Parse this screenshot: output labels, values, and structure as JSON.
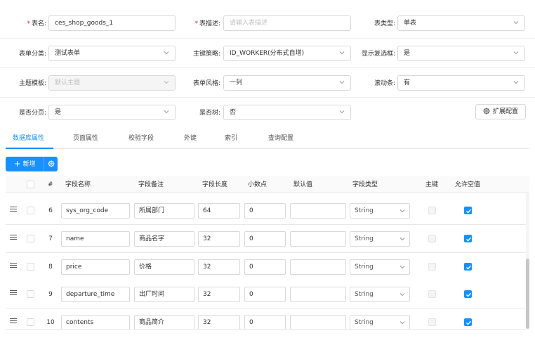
{
  "form": {
    "table_name": {
      "label": "表名:",
      "value": "ces_shop_goods_1"
    },
    "table_desc": {
      "label": "表描述:",
      "placeholder": "请输入表描述"
    },
    "table_type": {
      "label": "表类型:",
      "value": "单表"
    },
    "form_category": {
      "label": "表单分类:",
      "value": "测试表单"
    },
    "pk_strategy": {
      "label": "主键策略:",
      "value": "ID_WORKER(分布式自增)"
    },
    "show_checkbox": {
      "label": "显示复选框:",
      "value": "是"
    },
    "theme_template": {
      "label": "主题模板:",
      "value": "默认主题"
    },
    "form_style": {
      "label": "表单风格:",
      "value": "一列"
    },
    "scrollbar": {
      "label": "滚动条:",
      "value": "有"
    },
    "paging": {
      "label": "是否分页:",
      "value": "是"
    },
    "is_tree": {
      "label": "是否树:",
      "value": "否"
    },
    "extend_button": "扩展配置"
  },
  "tabs": [
    "数据库属性",
    "页面属性",
    "校验字段",
    "外键",
    "索引",
    "查询配置"
  ],
  "toolbar": {
    "add_label": "新增"
  },
  "table": {
    "columns": [
      "#",
      "字段名称",
      "字段备注",
      "字段长度",
      "小数点",
      "默认值",
      "字段类型",
      "主键",
      "允许空值"
    ],
    "rows": [
      {
        "num": "6",
        "name": "sys_org_code",
        "comment": "所属部门",
        "length": "64",
        "decimal": "0",
        "default": "",
        "type": "String",
        "primary": false,
        "nullable": true
      },
      {
        "num": "7",
        "name": "name",
        "comment": "商品名字",
        "length": "32",
        "decimal": "0",
        "default": "",
        "type": "String",
        "primary": false,
        "nullable": true
      },
      {
        "num": "8",
        "name": "price",
        "comment": "价格",
        "length": "32",
        "decimal": "0",
        "default": "",
        "type": "String",
        "primary": false,
        "nullable": true
      },
      {
        "num": "9",
        "name": "departure_time",
        "comment": "出厂时间",
        "length": "32",
        "decimal": "0",
        "default": "",
        "type": "String",
        "primary": false,
        "nullable": true
      },
      {
        "num": "10",
        "name": "contents",
        "comment": "商品简介",
        "length": "32",
        "decimal": "0",
        "default": "",
        "type": "String",
        "primary": false,
        "nullable": true
      }
    ]
  },
  "colors": {
    "primary": "#1890ff",
    "required": "#f5222d",
    "border": "#d9d9d9"
  }
}
